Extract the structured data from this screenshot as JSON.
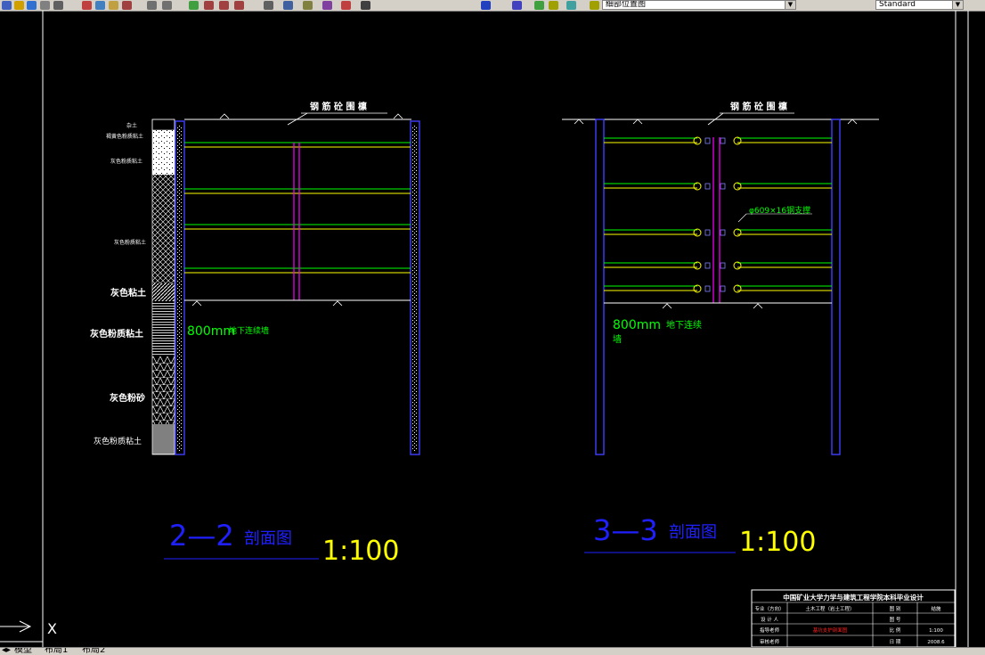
{
  "toolbar": {
    "layer_name": "细部位置图",
    "text_style": "Standard",
    "icons": [
      "new-icon",
      "open-icon",
      "save-icon",
      "print-icon",
      "preview-icon",
      "cut-icon",
      "copy-icon",
      "paste-icon",
      "match-prop-icon",
      "undo-icon",
      "redo-icon",
      "pan-icon",
      "zoom-realtime-icon",
      "zoom-window-icon",
      "zoom-previous-icon",
      "properties-icon",
      "design-center-icon",
      "tool-palette-icon",
      "sheet-set-icon",
      "markup-icon",
      "calculator-icon",
      "help-icon",
      "layer-manager-icon",
      "layer-state-icon",
      "make-current-icon",
      "layer-previous-icon",
      "text-style-icon"
    ]
  },
  "drawing": {
    "section22": {
      "title_num": "2—2",
      "title_text": "剖面图",
      "scale": "1:100",
      "top_label": "钢 筋 砼 围 檩",
      "wall_label_num": "800mm",
      "wall_label_text": "地下连续墙",
      "soil_layers": [
        "杂土",
        "褐黄色粉质粘土",
        "灰色粉质粘土",
        "灰色粉质粘土",
        "灰色粘土",
        "灰色粉质粘土",
        "灰色粉砂",
        "灰色粉质粘土"
      ]
    },
    "section33": {
      "title_num": "3—3",
      "title_text": "剖面图",
      "scale": "1:100",
      "top_label": "钢 筋 砼 围 檩",
      "wall_label_num": "800mm",
      "wall_label_text_1": "地下连续",
      "wall_label_text_2": "墙",
      "strut_label": "φ609×16钢支撑"
    },
    "title_block": {
      "header": "中国矿业大学力学与建筑工程学院本科毕业设计",
      "rows": [
        [
          "专业（方向）",
          "土木工程（岩土工程）",
          "图 别",
          "结施"
        ],
        [
          "设 计 人",
          "",
          "图 号",
          ""
        ],
        [
          "指导老师",
          "基坑支护剖面图",
          "比 例",
          "1:100"
        ],
        [
          "审核老师",
          "",
          "日 期",
          "2008.6"
        ]
      ]
    },
    "ucs_label": "X"
  },
  "tabs": {
    "model": "模型",
    "layout1": "布局1",
    "layout2": "布局2"
  }
}
